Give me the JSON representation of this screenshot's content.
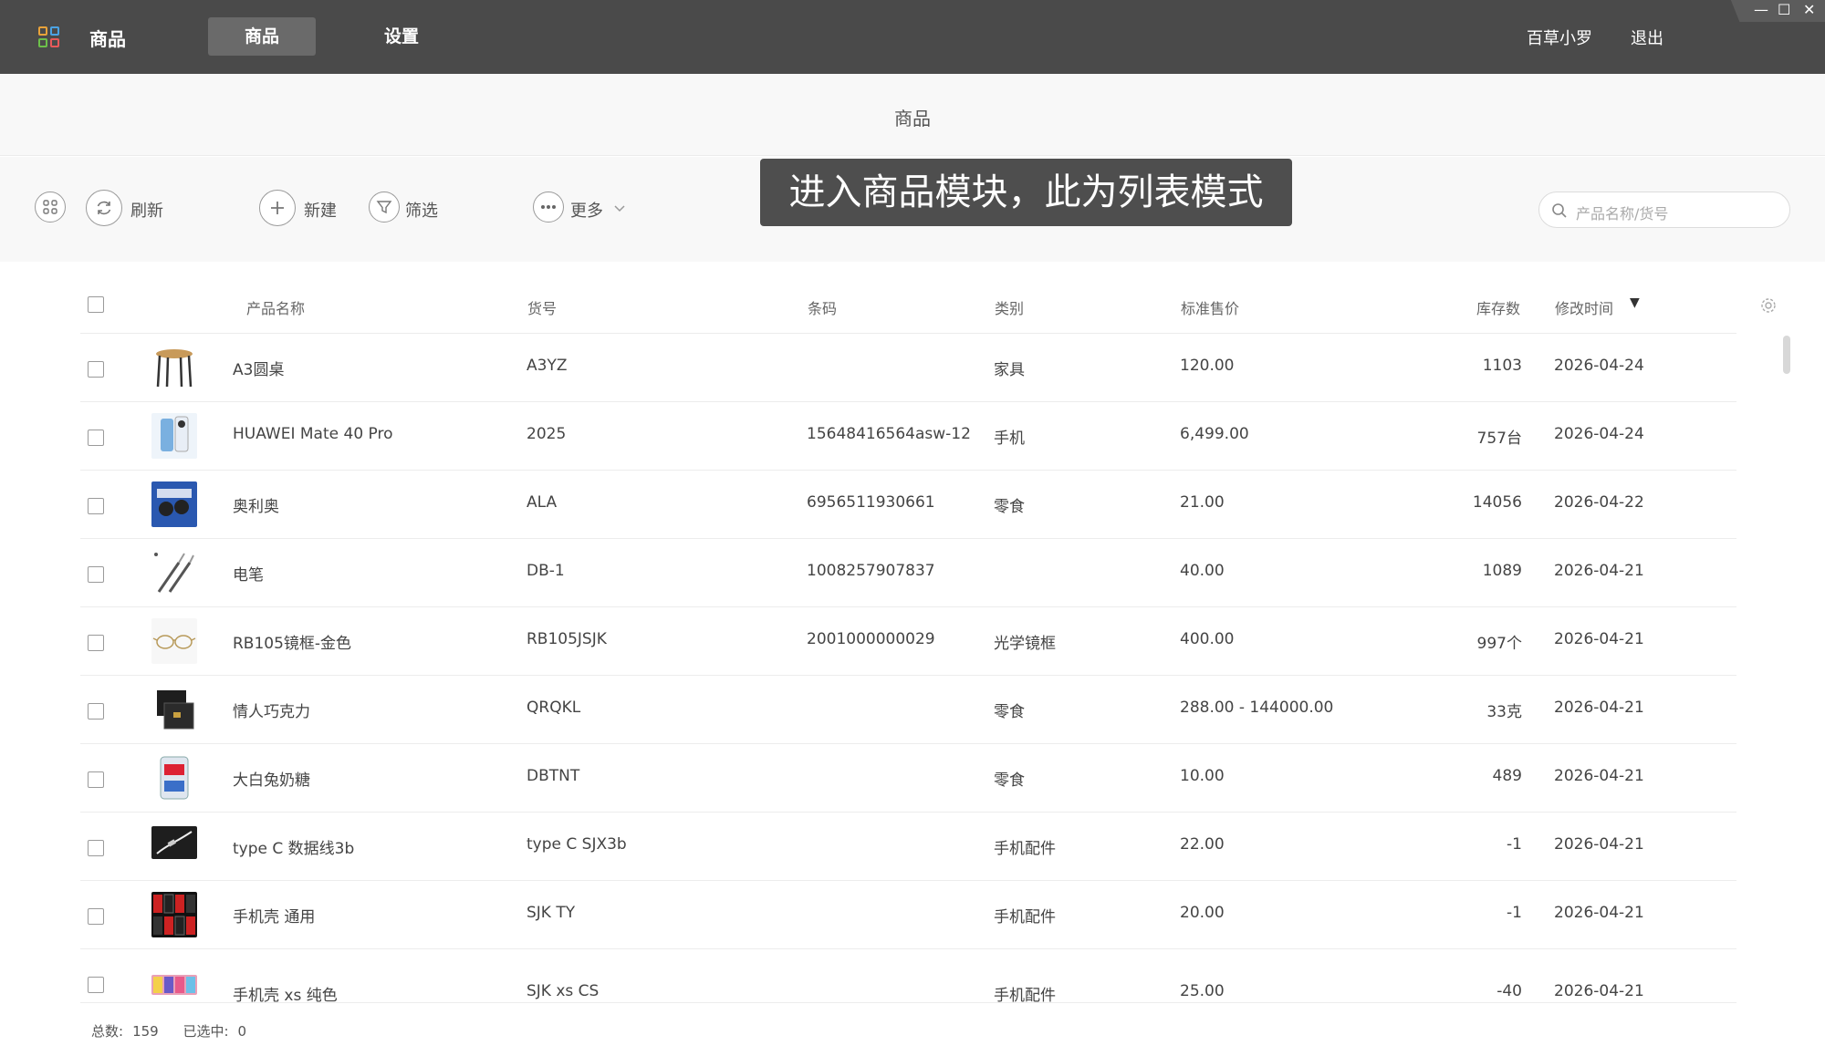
{
  "topbar": {
    "app_name": "商品",
    "tabs": [
      {
        "label": "商品",
        "active": true
      },
      {
        "label": "设置",
        "active": false
      }
    ],
    "user": "百草小罗",
    "logout": "退出",
    "window_controls": {
      "minimize": "—",
      "maximize": "☐",
      "close": "✕"
    }
  },
  "page": {
    "title": "商品"
  },
  "toolbar": {
    "refresh": "刷新",
    "new": "新建",
    "filter": "筛选",
    "more": "更多",
    "search_placeholder": "产品名称/货号"
  },
  "caption": "进入商品模块，此为列表模式",
  "table": {
    "columns": [
      "产品名称",
      "货号",
      "条码",
      "类别",
      "标准售价",
      "库存数",
      "修改时间"
    ],
    "sort_indicator": "▼",
    "rows": [
      {
        "name": "A3圆桌",
        "sku": "A3YZ",
        "barcode": "",
        "category": "家具",
        "price": "120.00",
        "stock": "1103",
        "modified": "2026-04-24"
      },
      {
        "name": "HUAWEI Mate 40 Pro",
        "sku": "2025",
        "barcode": "15648416564asw-12",
        "category": "手机",
        "price": "6,499.00",
        "stock": "757台",
        "modified": "2026-04-24"
      },
      {
        "name": "奥利奥",
        "sku": "ALA",
        "barcode": "6956511930661",
        "category": "零食",
        "price": "21.00",
        "stock": "14056",
        "modified": "2026-04-22"
      },
      {
        "name": "电笔",
        "sku": "DB-1",
        "barcode": "1008257907837",
        "category": "",
        "price": "40.00",
        "stock": "1089",
        "modified": "2026-04-21"
      },
      {
        "name": "RB105镜框-金色",
        "sku": "RB105JSJK",
        "barcode": "2001000000029",
        "category": "光学镜框",
        "price": "400.00",
        "stock": "997个",
        "modified": "2026-04-21"
      },
      {
        "name": "情人巧克力",
        "sku": "QRQKL",
        "barcode": "",
        "category": "零食",
        "price": "288.00 - 144000.00",
        "stock": "33克",
        "modified": "2026-04-21"
      },
      {
        "name": "大白兔奶糖",
        "sku": "DBTNT",
        "barcode": "",
        "category": "零食",
        "price": "10.00",
        "stock": "489",
        "modified": "2026-04-21"
      },
      {
        "name": "type C 数据线3b",
        "sku": "type C SJX3b",
        "barcode": "",
        "category": "手机配件",
        "price": "22.00",
        "stock": "-1",
        "modified": "2026-04-21"
      },
      {
        "name": "手机壳 通用",
        "sku": "SJK TY",
        "barcode": "",
        "category": "手机配件",
        "price": "20.00",
        "stock": "-1",
        "modified": "2026-04-21"
      },
      {
        "name": "手机壳 xs 纯色",
        "sku": "SJK xs CS",
        "barcode": "",
        "category": "手机配件",
        "price": "25.00",
        "stock": "-40",
        "modified": "2026-04-21"
      }
    ]
  },
  "footer": {
    "total_label": "总数:",
    "total": "159",
    "selected_label": "已选中:",
    "selected": "0"
  },
  "colors": {
    "topbar": "#4a4a4a",
    "caption_bg": "#4e4e4e",
    "page_bg": "#f8f8f8"
  }
}
